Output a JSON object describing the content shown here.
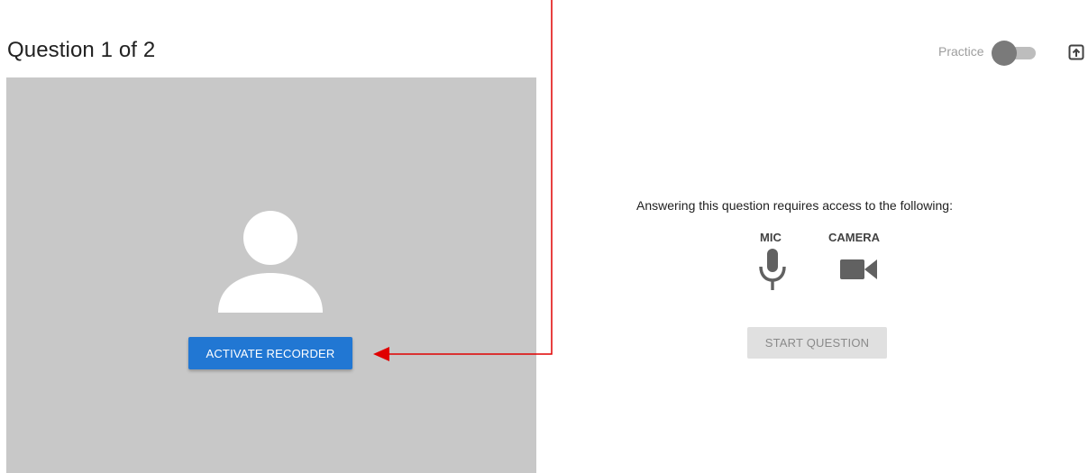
{
  "header": {
    "question_title": "Question 1 of 2",
    "practice_label": "Practice",
    "practice_enabled": false
  },
  "recorder": {
    "activate_label": "ACTIVATE RECORDER",
    "avatar_icon": "person-silhouette-icon"
  },
  "requirements": {
    "message": "Answering this question requires access to the following:",
    "items": [
      {
        "label": "MIC",
        "icon": "microphone-icon"
      },
      {
        "label": "CAMERA",
        "icon": "videocam-icon"
      }
    ]
  },
  "actions": {
    "start_label": "START QUESTION",
    "start_enabled": false
  },
  "icons": {
    "export": "export-box-icon"
  },
  "colors": {
    "primary": "#2177d3",
    "panel_bg": "#c8c8c8",
    "annotation_arrow": "#e00000",
    "disabled_bg": "#e0e0e0",
    "icon_gray": "#616161"
  }
}
